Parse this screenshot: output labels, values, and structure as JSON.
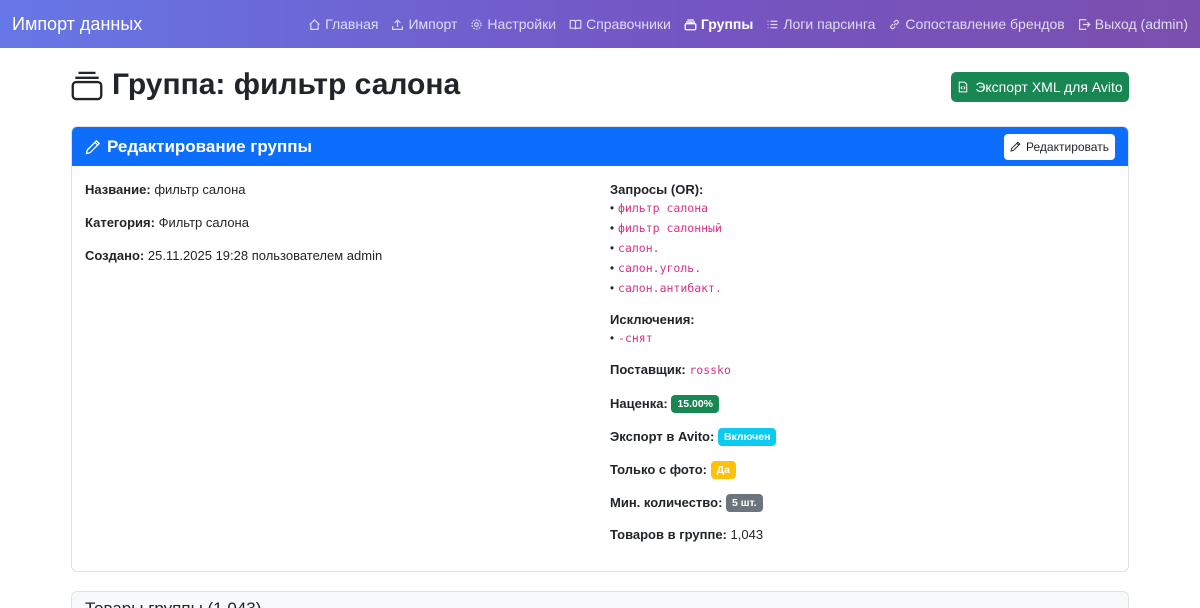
{
  "navbar": {
    "brand": "Импорт данных",
    "items": [
      {
        "label": "Главная",
        "icon": "house-icon",
        "active": false
      },
      {
        "label": "Импорт",
        "icon": "upload-icon",
        "active": false
      },
      {
        "label": "Настройки",
        "icon": "gear-icon",
        "active": false
      },
      {
        "label": "Справочники",
        "icon": "book-icon",
        "active": false
      },
      {
        "label": "Группы",
        "icon": "collection-icon",
        "active": true
      },
      {
        "label": "Логи парсинга",
        "icon": "list-icon",
        "active": false
      },
      {
        "label": "Сопоставление брендов",
        "icon": "link-icon",
        "active": false
      },
      {
        "label": "Выход (admin)",
        "icon": "logout-icon",
        "active": false
      }
    ]
  },
  "page": {
    "title": "Группа: фильтр салона",
    "export_button": "Экспорт XML для Avito"
  },
  "card": {
    "header": "Редактирование группы",
    "edit_button": "Редактировать",
    "name_label": "Название:",
    "name_value": "фильтр салона",
    "category_label": "Категория:",
    "category_value": "Фильтр салона",
    "created_label": "Создано:",
    "created_value": "25.11.2025 19:28 пользователем admin",
    "queries_label": "Запросы (OR):",
    "queries": [
      "фильтр салона",
      "фильтр салонный",
      "салон.",
      "салон.уголь.",
      "салон.антибакт."
    ],
    "exclusions_label": "Исключения:",
    "exclusions": [
      "-снят"
    ],
    "supplier_label": "Поставщик:",
    "supplier_value": "rossko",
    "markup_label": "Наценка:",
    "markup_value": "15.00%",
    "avito_label": "Экспорт в Avito:",
    "avito_value": "Включен",
    "photo_label": "Только с фото:",
    "photo_value": "Да",
    "min_qty_label": "Мин. количество:",
    "min_qty_value": "5 шт.",
    "items_label": "Товаров в группе:",
    "items_value": "1,043"
  },
  "products_card": {
    "title": "Товары группы (1,043)"
  },
  "colors": {
    "primary": "#0d6efd",
    "success": "#198754",
    "info": "#0dcaf0",
    "warning": "#ffc107",
    "secondary": "#6c757d",
    "code": "#d63384"
  }
}
